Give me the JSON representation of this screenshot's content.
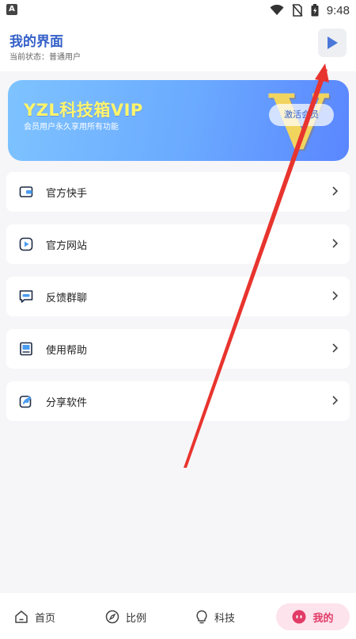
{
  "status_bar": {
    "time": "9:48",
    "left_badge": "A"
  },
  "header": {
    "title": "我的界面",
    "subtitle": "当前状态：普通用户"
  },
  "vip_card": {
    "title": "YZL科技箱VIP",
    "subtitle": "会员用户永久享用所有功能",
    "button_label": "激活会员",
    "emblem": "V",
    "colors": {
      "gradient_start": "#7ec3ff",
      "gradient_end": "#5a86ff",
      "title": "#fff56b",
      "emblem": "#f1d45e"
    }
  },
  "menu": {
    "items": [
      {
        "label": "官方快手",
        "icon": "wallet-icon"
      },
      {
        "label": "官方网站",
        "icon": "play-square-icon"
      },
      {
        "label": "反馈群聊",
        "icon": "chat-icon"
      },
      {
        "label": "使用帮助",
        "icon": "book-icon"
      },
      {
        "label": "分享软件",
        "icon": "share-icon"
      }
    ]
  },
  "tabbar": {
    "tabs": [
      {
        "label": "首页",
        "icon": "home-icon"
      },
      {
        "label": "比例",
        "icon": "compass-icon"
      },
      {
        "label": "科技",
        "icon": "bulb-icon"
      },
      {
        "label": "我的",
        "icon": "face-icon",
        "active": true
      }
    ],
    "colors": {
      "active_bg": "#fde3ec",
      "active_text": "#e23b67"
    }
  },
  "colors": {
    "accent": "#3460c8",
    "annotation_arrow": "#e8342e"
  }
}
